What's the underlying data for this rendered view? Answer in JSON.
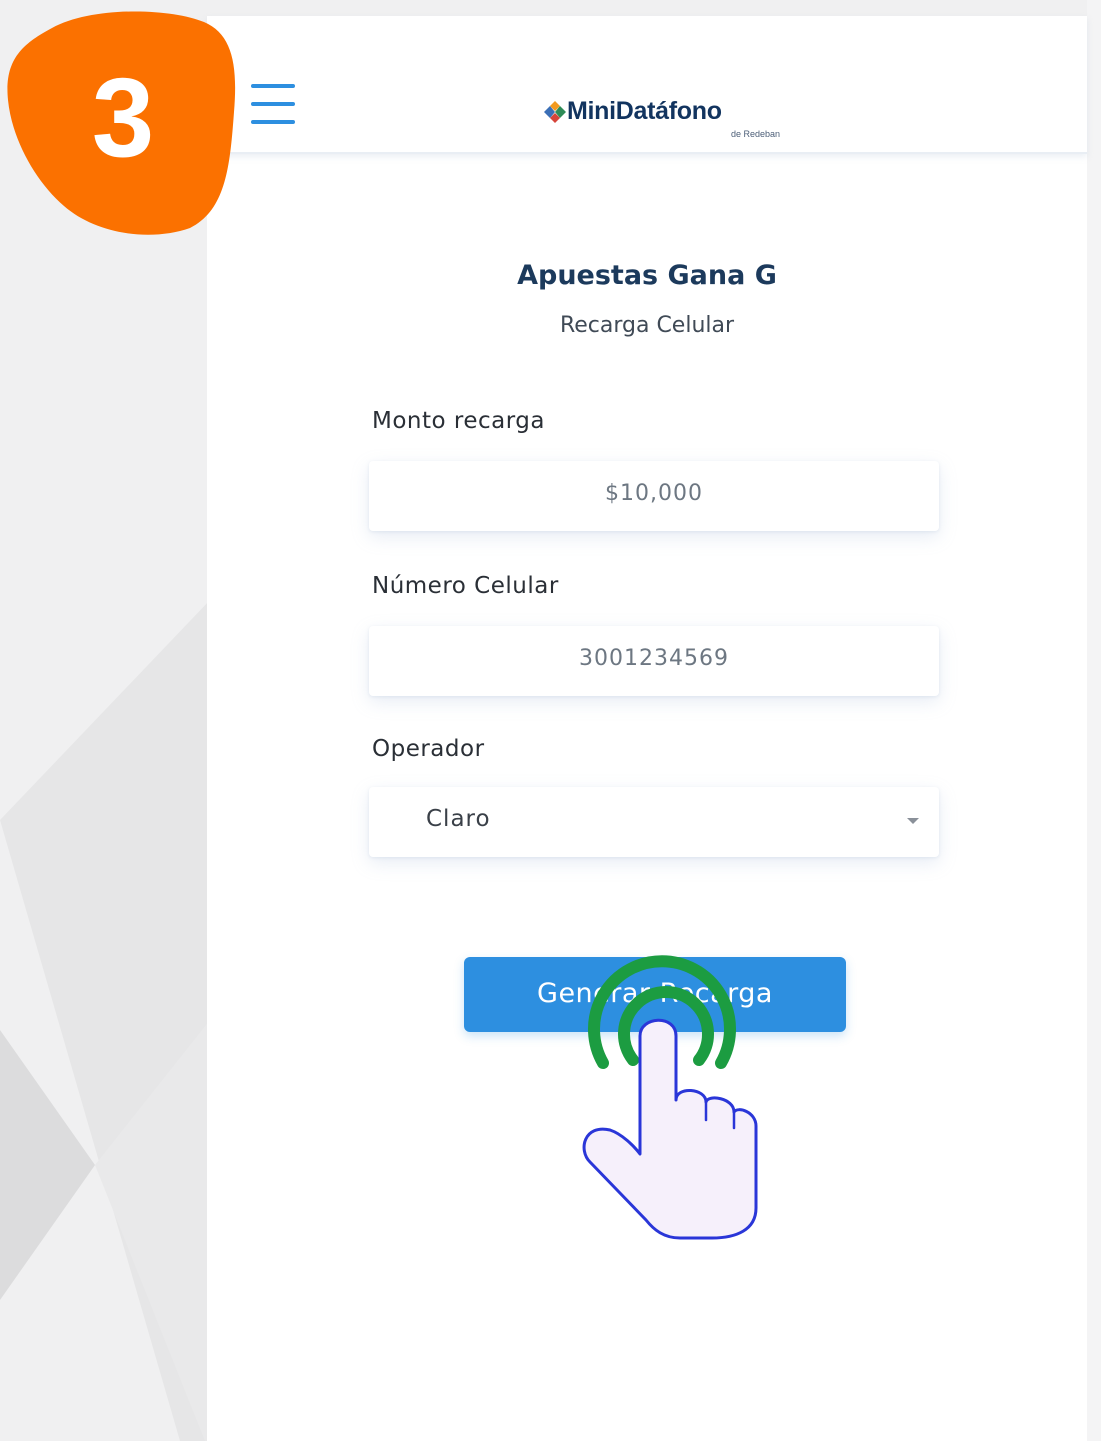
{
  "step": {
    "number": "3",
    "color": "#fb7100"
  },
  "header": {
    "menu_icon": "hamburger-menu-icon",
    "logo": {
      "brand": "MiniDatáfono",
      "subtitle": "de Redeban"
    }
  },
  "form": {
    "merchant_name": "Apuestas Gana G",
    "service_name": "Recarga Celular",
    "amount": {
      "label": "Monto recarga",
      "value": "$10,000"
    },
    "phone": {
      "label": "Número Celular",
      "value": "3001234569"
    },
    "operator": {
      "label": "Operador",
      "selected": "Claro",
      "dropdown_icon": "caret-down-icon"
    },
    "submit_label": "Generar Recarga"
  },
  "tap_indicator": {
    "icon": "hand-pointer-icon",
    "ring_color": "#1c9c41"
  },
  "colors": {
    "primary": "#2d8fe0",
    "title": "#1c3a5c",
    "background": "#f0f0f1"
  }
}
